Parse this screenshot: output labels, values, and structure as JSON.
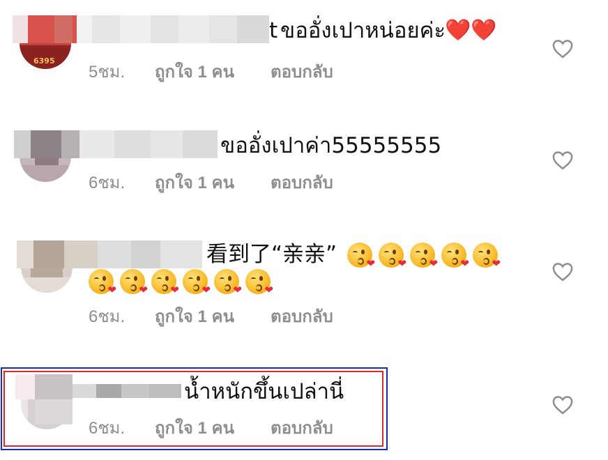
{
  "comments": [
    {
      "text_visible_tail": "t",
      "text": "ขออั่งเปาหน่อยค่ะ",
      "emoji": "❤️❤️",
      "time": "5ชม.",
      "likes": "ถูกใจ 1 คน",
      "reply": "ตอบกลับ",
      "avatar_caption": "6395"
    },
    {
      "text": "ขออั่งเปาค่า55555555",
      "time": "6ชม.",
      "likes": "ถูกใจ 1 คน",
      "reply": "ตอบกลับ"
    },
    {
      "text": "看到了“亲亲”",
      "emoji_name": "face-blowing-kiss",
      "emoji_count_line1": 5,
      "emoji_count_line2": 6,
      "time": "6ชม.",
      "likes": "ถูกใจ 1 คน",
      "reply": "ตอบกลับ"
    },
    {
      "text": "น้ำหนักขึ้นเปล่านี่",
      "time": "6ชม.",
      "likes": "ถูกใจ 1 คน",
      "reply": "ตอบกลับ",
      "highlighted": true
    }
  ],
  "icons": {
    "like": "heart-outline-icon"
  },
  "colors": {
    "meta_text": "#8e8e8e",
    "highlight_outer": "#1b2bb0",
    "highlight_inner": "#e2262b",
    "heart_emoji": "#e8212d"
  }
}
